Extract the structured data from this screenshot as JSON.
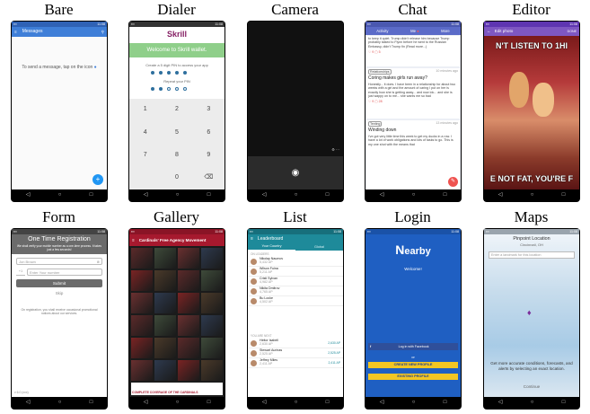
{
  "captions": [
    "Bare",
    "Dialer",
    "Camera",
    "Chat",
    "Editor",
    "Form",
    "Gallery",
    "List",
    "Login",
    "Maps"
  ],
  "status_time": "11:08",
  "bare": {
    "title": "Messages",
    "empty_text": "To send a message, tap on the icon",
    "fab": "+"
  },
  "dialer": {
    "logo": "Skrill",
    "welcome": "Welcome to Skrill wallet.",
    "prompt": "Create a 5 digit PIN to access your app",
    "repeat": "Repeat your PIN",
    "keys": [
      "1",
      "2",
      "3",
      "4",
      "5",
      "6",
      "7",
      "8",
      "9",
      "0",
      "⌫"
    ]
  },
  "camera": {
    "shutter": "◉"
  },
  "chat": {
    "tabs": [
      "Activity",
      "Me",
      "More"
    ],
    "posts": [
      {
        "text": "to keep it quiet. Trump didn't release him because Trump probably talked to Flynn before he went to the Russian Embassy, didn't Trump fin (Read more...)",
        "likes": "9",
        "comments": "5"
      },
      {
        "tag": "Relationships",
        "time": "10 minutes ago",
        "title": "Coring makes girls run away?",
        "text": "Honestly... it does. I have been in a relationship for about two weeks with a girl and the amount of caring I put on her is exactly how she is getting away... and now idc... and she is just wappy on to me... she wants me so bad",
        "likes": "9",
        "comments": "28"
      },
      {
        "tag": "Texting",
        "time": "13 minutes ago",
        "title": "Winding down",
        "text": "I've got very little time this week to get my ducks in a row. I have a lot of work obligations and lots of tasks to go. This is my one shot with the means that"
      }
    ]
  },
  "editor": {
    "title": "Edit photo",
    "done": "DONE",
    "top_text": "N'T LISTEN TO 1HI",
    "bottom_text": "E NOT FAT, YOU'RE F"
  },
  "form": {
    "title": "One Time Registration",
    "subtitle": "We shall verify your mobile number as a one-time process. It takes just a few seconds!",
    "name_placeholder": "Jon Brown",
    "phone_code": "+1",
    "phone_placeholder": "Enter Your number",
    "submit": "Submit",
    "skip": "Skip",
    "terms": "On registration, you shall receive occasional promotional notices about our services.",
    "footer": "v 6.0 (xxx)"
  },
  "gallery": {
    "title": "Cardinals' Free Agency Movement",
    "banner": "COMPLETE COVERAGE OF THE CARDINALS"
  },
  "list": {
    "title": "Leaderboard",
    "tabs": [
      "Your Country",
      "Global"
    ],
    "section1": "ON LEADERS",
    "section2": "YOU ARE NEXT",
    "rows": [
      {
        "name": "Nikolay Naumov",
        "sub": "5,432 AP",
        "score": ""
      },
      {
        "name": "Wilson Fuina",
        "sub": "5,211 AP",
        "score": ""
      },
      {
        "name": "Cristi Sylvan",
        "sub": "4,982 AP",
        "score": ""
      },
      {
        "name": "Nikita Dmitrov",
        "sub": "4,765 AP",
        "score": ""
      },
      {
        "name": "Bu Locke",
        "sub": "4,502 AP",
        "score": ""
      },
      {
        "name": "Heitor Isabell",
        "sub": "2,630 AP",
        "score": "2,630 AP"
      },
      {
        "name": "Stewart Aurinas",
        "sub": "2,525 AP",
        "score": "2,525 AP"
      },
      {
        "name": "Jeffrey Miles",
        "sub": "2,411 AP",
        "score": "2,411 AP"
      }
    ]
  },
  "login": {
    "logo_letter": "N",
    "logo_rest": "earby",
    "welcome": "Welcome!",
    "facebook": "Log in with Facebook",
    "or": "or",
    "create": "CREATE NEW PROFILE",
    "existing": "EXISTING PROFILE"
  },
  "maps": {
    "title": "Pinpoint Location",
    "subtitle": "Cincinnati, OH",
    "placeholder": "Enter a landmark for this location",
    "info": "Get more accurate conditions, forecasts, and alerts by selecting an exact location.",
    "continue": "Continue"
  },
  "colors": {
    "blue": "#3f7fd8",
    "skrill": "#862165",
    "skrill_green": "#8fcf8a",
    "chat_purple": "#5b6bc8",
    "editor_purple": "#7e57c2",
    "gallery_red": "#a6192e",
    "list_teal": "#1e8a9a",
    "login_blue": "#1f5fc2",
    "gold": "#f3c623",
    "maps_sky": "#a8cbe6"
  }
}
